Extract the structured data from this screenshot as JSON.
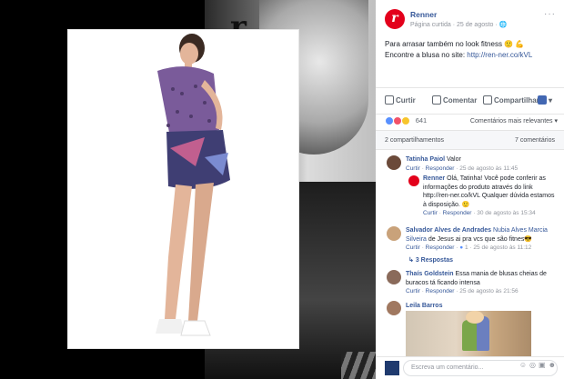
{
  "post": {
    "page_name": "Renner",
    "page_meta": "Página curtida · 25 de agosto · 🌐",
    "text_line1": "Para arrasar também no look fitness 🙂 💪",
    "text_line2_prefix": "Encontre a blusa no site: ",
    "link": "http://ren-ner.co/kVL",
    "more": "···"
  },
  "actions": {
    "like": "Curtir",
    "comment": "Comentar",
    "share": "Compartilhar"
  },
  "reactions": {
    "count": "641",
    "sort": "Comentários mais relevantes ▾",
    "colors": [
      "#5890ff",
      "#f25268",
      "#f7c52c"
    ]
  },
  "stats": {
    "shares": "2 compartilhamentos",
    "comments": "7 comentários"
  },
  "comments": [
    {
      "name": "Tatinha Paiol",
      "text": "Valor",
      "like": "Curtir",
      "reply": "Responder",
      "time": "25 de agosto às 11:45"
    },
    {
      "name": "Renner",
      "text": "Olá, Tatinha! Você pode conferir as informações do produto através do link",
      "text2": "http://ren-ner.co/kVL Qualquer dúvida estamos à disposição. 🙂",
      "like": "Curtir",
      "reply": "Responder",
      "time": "30 de agosto às 15:34"
    },
    {
      "name": "Salvador Alves de Andrades",
      "mention": "Nubia Alves Marcia Silveira",
      "text": " de Jesus ai pra vcs que são fitnes😎",
      "like": "Curtir",
      "reply": "Responder",
      "likes": "1",
      "time": "25 de agosto às 11:12"
    },
    {
      "replies": "3 Respostas"
    },
    {
      "name": "Thaís Goldstein",
      "text": "Essa mania de blusas cheias de buracos tá ficando intensa",
      "like": "Curtir",
      "reply": "Responder",
      "time": "25 de agosto às 21:56"
    },
    {
      "name": "Leila Barros"
    }
  ],
  "write": {
    "placeholder": "Escreva um comentário..."
  }
}
